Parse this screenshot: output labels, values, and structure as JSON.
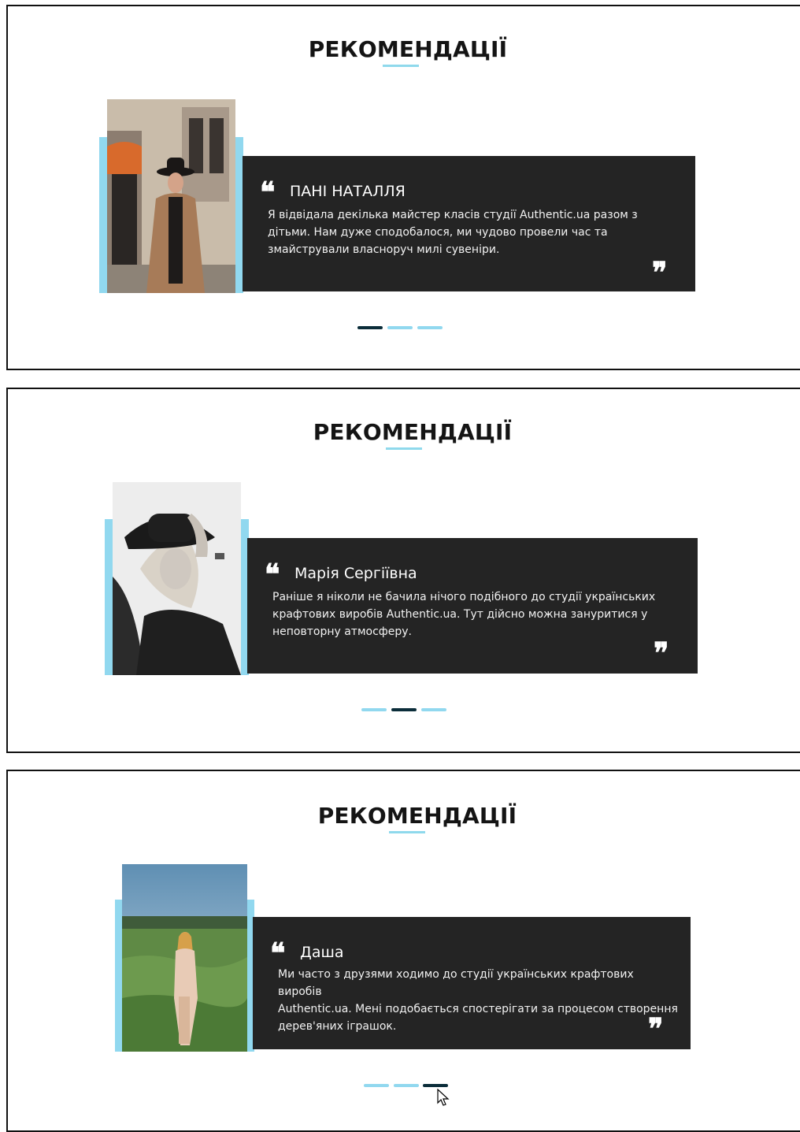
{
  "section_title": "РЕКОМЕНДАЦІЇ",
  "colors": {
    "accent": "#91d8ef",
    "dark": "#242424",
    "active_dot": "#0b2d3a"
  },
  "slides": [
    {
      "name": "ПАНІ НАТАЛЛЯ",
      "text": "Я відвідала декілька майстер класів студії Authentic.ua разом з\nдітьми. Нам дуже сподобалося, ми чудово провели час та\nзмайстрували власноруч милі сувеніри.",
      "photo": "woman-in-hat-city-photo"
    },
    {
      "name": "Марія Сергіївна",
      "text": "Раніше я ніколи не бачила нічого подібного до студії українських\nкрафтових виробів Authentic.ua. Тут дійсно можна зануритися у\nнеповторну атмосферу.",
      "photo": "woman-in-hat-bw-photo"
    },
    {
      "name": "Даша",
      "text": "Ми часто з друзями ходимо до студії українських крафтових виробів\nAuthentic.ua. Мені подобається спостерігати за процесом створення\nдерев'яних іграшок.",
      "photo": "woman-in-field-photo"
    }
  ],
  "pagination": [
    {
      "active_index": 0
    },
    {
      "active_index": 1
    },
    {
      "active_index": 2
    }
  ],
  "quote_open_glyph": "❝",
  "quote_close_glyph": "❞"
}
